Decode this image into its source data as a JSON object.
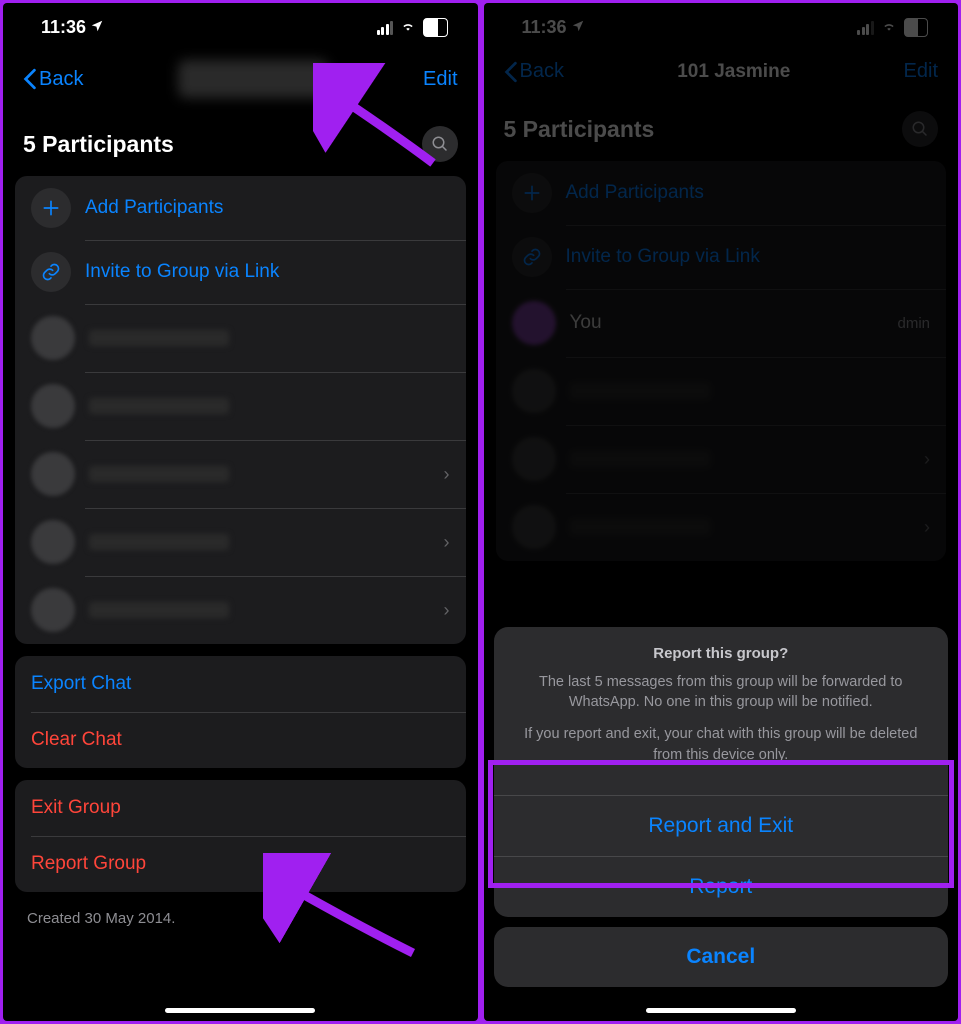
{
  "status": {
    "time": "11:36",
    "battery": "60"
  },
  "left": {
    "nav": {
      "back": "Back",
      "edit": "Edit"
    },
    "participants_header": "5 Participants",
    "add_participants": "Add Participants",
    "invite_link": "Invite to Group via Link",
    "export_chat": "Export Chat",
    "clear_chat": "Clear Chat",
    "exit_group": "Exit Group",
    "report_group": "Report Group",
    "created": "Created 30 May 2014."
  },
  "right": {
    "nav": {
      "back": "Back",
      "title": "101 Jasmine",
      "edit": "Edit"
    },
    "participants_header": "5 Participants",
    "add_participants": "Add Participants",
    "invite_link": "Invite to Group via Link",
    "you": "You",
    "admin": "dmin",
    "sheet": {
      "title": "Report this group?",
      "line1": "The last 5 messages from this group will be forwarded to WhatsApp. No one in this group will be notified.",
      "line2": "If you report and exit, your chat with this group will be deleted from this device only.",
      "report_exit": "Report and Exit",
      "report": "Report",
      "cancel": "Cancel"
    }
  }
}
